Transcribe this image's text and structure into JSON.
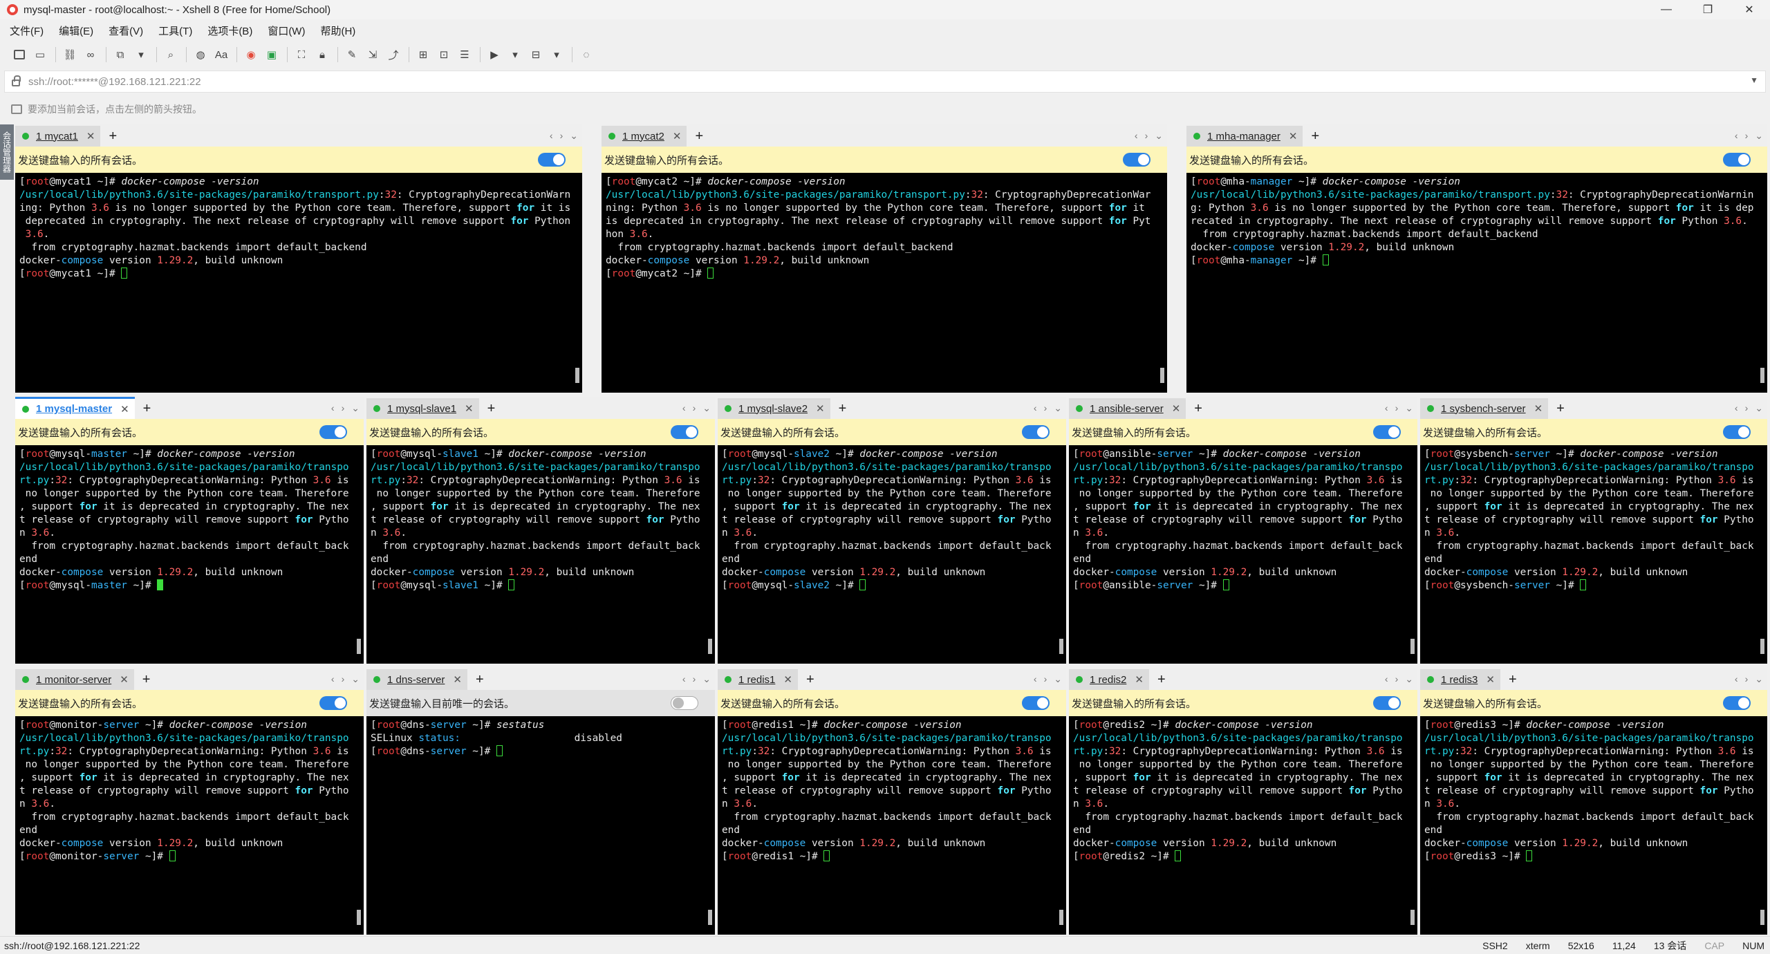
{
  "window": {
    "title": "mysql-master - root@localhost:~ - Xshell 8 (Free for Home/School)",
    "controls": [
      "—",
      "❐",
      "✕"
    ]
  },
  "menu": [
    "文件(F)",
    "编辑(E)",
    "查看(V)",
    "工具(T)",
    "选项卡(B)",
    "窗口(W)",
    "帮助(H)"
  ],
  "address": {
    "text": "ssh://root:******@192.168.121.221:22",
    "dropdown": "▼"
  },
  "hint": "要添加当前会话，点击左侧的箭头按钮。",
  "sidebar_tab": "会话管理器",
  "send_all": "发送键盘输入的所有会话。",
  "send_one": "发送键盘输入目前唯一的会话。",
  "cmd": "docker-compose -version",
  "warn": {
    "path_prefix": "/usr/local/lib/",
    "python_dir": "python3.6",
    "path_mid": "/site-packages/paramiko/",
    "path_file": "transport.py",
    "line_no": "32",
    "category": ": CryptographyDeprecationWarning: Python ",
    "version": "3.6",
    "msg1": " is no longer supported by the Python core team. Therefore, support ",
    "kw_for": "for",
    "msg2": " it is deprecated in cryptography. The next release of cryptography will remove support ",
    "msg3": " Python ",
    "import_line": "  from cryptography.hazmat.backends import default_backend"
  },
  "dc": {
    "name": "docker-compose",
    "ver_pre": " version ",
    "ver": "1.29.2",
    "ver_post": ", build unknown"
  },
  "dns": {
    "cmd": "sestatus",
    "label": "SELinux",
    "status": " status:",
    "value": "disabled"
  },
  "tabs": [
    {
      "name": "1 mycat1",
      "host": "mycat1"
    },
    {
      "name": "1 mycat2",
      "host": "mycat2"
    },
    {
      "name": "1 mha-manager",
      "host": "mha-manager"
    },
    {
      "name": "1 mysql-master",
      "host": "mysql-master"
    },
    {
      "name": "1 mysql-slave1",
      "host": "mysql-slave1"
    },
    {
      "name": "1 mysql-slave2",
      "host": "mysql-slave2"
    },
    {
      "name": "1 ansible-server",
      "host": "ansible-server"
    },
    {
      "name": "1 sysbench-server",
      "host": "sysbench-server"
    },
    {
      "name": "1 monitor-server",
      "host": "monitor-server"
    },
    {
      "name": "1 dns-server",
      "host": "dns-server"
    },
    {
      "name": "1 redis1",
      "host": "redis1"
    },
    {
      "name": "1 redis2",
      "host": "redis2"
    },
    {
      "name": "1 redis3",
      "host": "redis3"
    }
  ],
  "active_tab": "1 mysql-master",
  "status": {
    "left": "ssh://root@192.168.121.221:22",
    "protocol": "SSH2",
    "term": "xterm",
    "size": "52x16",
    "pos": "11,24",
    "sessions": "13 会话",
    "cap": "CAP",
    "num": "NUM"
  }
}
